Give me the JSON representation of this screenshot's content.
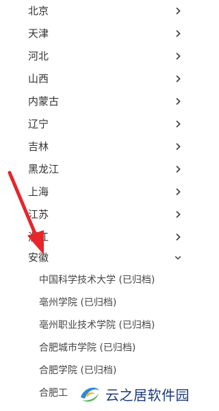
{
  "provinces": [
    {
      "label": "北京",
      "icon": "chevron-right-icon"
    },
    {
      "label": "天津",
      "icon": "chevron-right-icon"
    },
    {
      "label": "河北",
      "icon": "chevron-right-icon"
    },
    {
      "label": "山西",
      "icon": "chevron-right-icon"
    },
    {
      "label": "内蒙古",
      "icon": "chevron-right-icon"
    },
    {
      "label": "辽宁",
      "icon": "chevron-right-icon"
    },
    {
      "label": "吉林",
      "icon": "chevron-right-icon"
    },
    {
      "label": "黑龙江",
      "icon": "chevron-right-icon"
    },
    {
      "label": "上海",
      "icon": "chevron-right-icon"
    },
    {
      "label": "江苏",
      "icon": "chevron-right-icon"
    },
    {
      "label": "浙江",
      "icon": "chevron-right-icon"
    },
    {
      "label": "安徽",
      "icon": "chevron-down-icon",
      "expanded": true
    }
  ],
  "anhui_schools": [
    {
      "label": "中国科学技术大学 (已归档)"
    },
    {
      "label": "亳州学院 (已归档)"
    },
    {
      "label": "亳州职业技术学院 (已归档)"
    },
    {
      "label": "合肥城市学院 (已归档)"
    },
    {
      "label": "合肥学院 (已归档)"
    },
    {
      "label": "合肥工"
    }
  ],
  "watermark": {
    "text": "云之居软件园"
  },
  "colors": {
    "text": "#333333",
    "arrow": "#e8252a",
    "chevron": "#444444",
    "watermark": "#1a3a7a"
  }
}
